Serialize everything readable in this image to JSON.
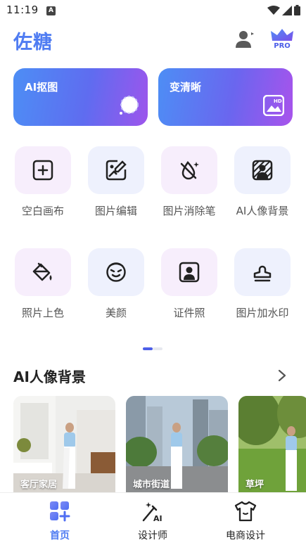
{
  "status_bar": {
    "time": "11:19",
    "notification_letter": "A"
  },
  "header": {
    "app_title": "佐糖",
    "pro_label": "PRO"
  },
  "banners": [
    {
      "label": "AI抠图",
      "icon": "cutout-circle-icon"
    },
    {
      "label": "变清晰",
      "icon": "hd-image-icon"
    }
  ],
  "tools": [
    {
      "label": "空白画布",
      "icon": "blank-canvas-icon"
    },
    {
      "label": "图片编辑",
      "icon": "image-edit-icon"
    },
    {
      "label": "图片消除笔",
      "icon": "eraser-pen-icon"
    },
    {
      "label": "AI人像背景",
      "icon": "portrait-background-icon"
    },
    {
      "label": "照片上色",
      "icon": "paint-bucket-icon"
    },
    {
      "label": "美颜",
      "icon": "beauty-face-icon"
    },
    {
      "label": "证件照",
      "icon": "id-photo-icon"
    },
    {
      "label": "图片加水印",
      "icon": "watermark-stamp-icon"
    }
  ],
  "section": {
    "title": "AI人像背景"
  },
  "thumbnails": [
    {
      "label": "客厅家居"
    },
    {
      "label": "城市街道"
    },
    {
      "label": "草坪"
    }
  ],
  "bottom_nav": [
    {
      "label": "首页",
      "icon": "home-grid-icon",
      "active": true
    },
    {
      "label": "设计师",
      "icon": "ai-wand-icon",
      "active": false
    },
    {
      "label": "电商设计",
      "icon": "tshirt-icon",
      "active": false
    }
  ],
  "colors": {
    "accent": "#4f7cf2",
    "pro": "#4c5ee8"
  }
}
